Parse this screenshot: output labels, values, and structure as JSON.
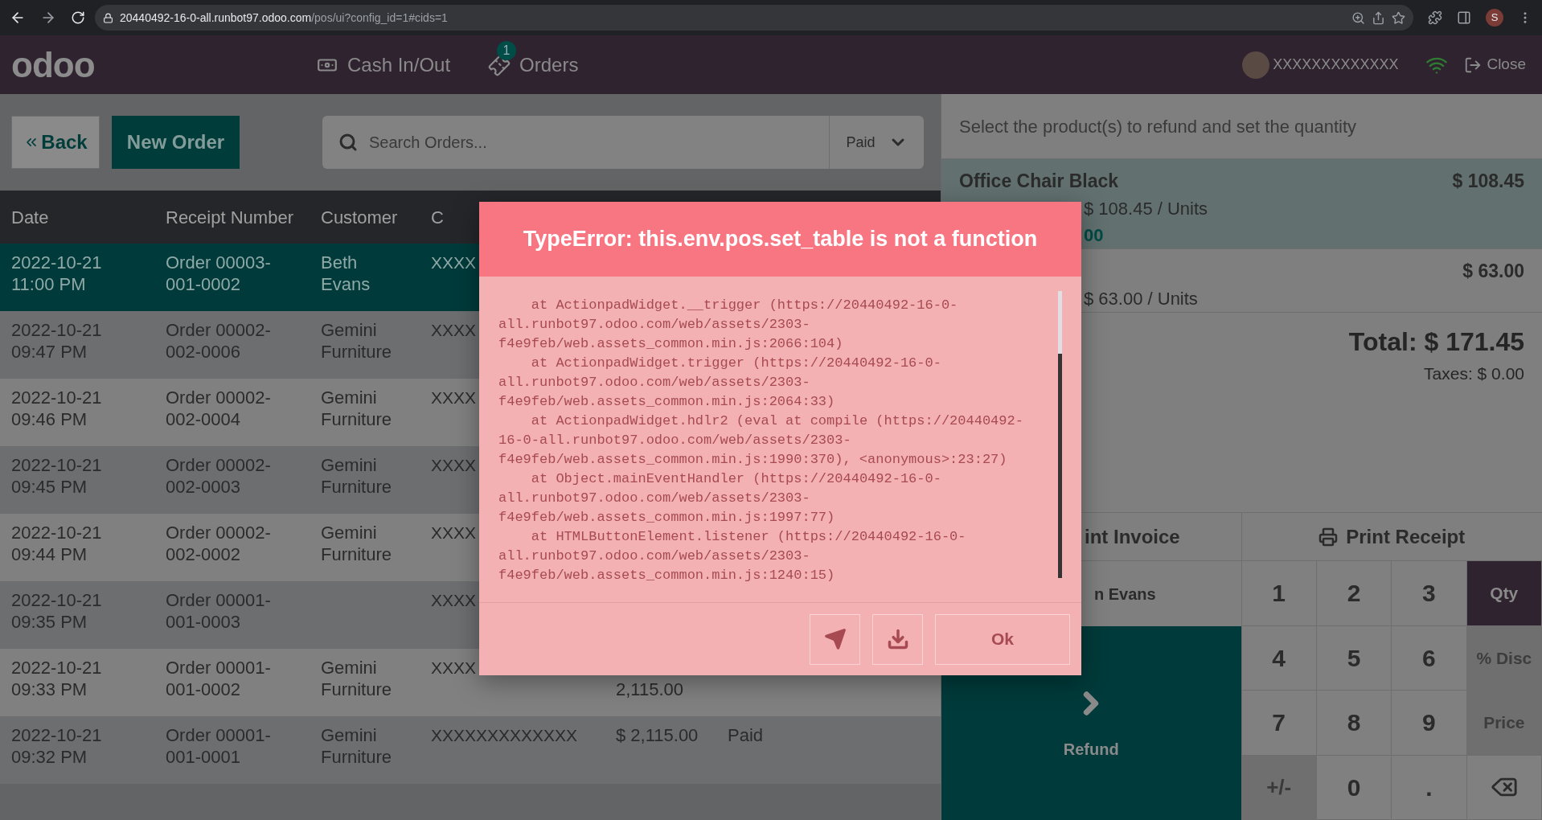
{
  "browser": {
    "url_host": "20440492-16-0-all.runbot97.odoo.com",
    "url_path": "/pos/ui?config_id=1#cids=1",
    "profile_initial": "S"
  },
  "header": {
    "logo": "odoo",
    "nav": [
      {
        "kind": "cash",
        "label": "Cash In/Out"
      },
      {
        "kind": "orders",
        "label": "Orders",
        "badge": "1"
      }
    ],
    "user": "XXXXXXXXXXXXX",
    "close": "Close"
  },
  "controls": {
    "back": "Back",
    "new_order": "New Order",
    "search": {
      "placeholder": "Search Orders..."
    },
    "filter": "Paid"
  },
  "table": {
    "columns": [
      "Date",
      "Receipt Number",
      "Customer",
      "C"
    ],
    "rows": [
      {
        "selected": true,
        "date": "2022-10-21 11:00 PM",
        "receipt": "Order 00003-001-0002",
        "customer": "Beth Evans",
        "column_4": "XXXX"
      },
      {
        "selected": false,
        "date": "2022-10-21 09:47 PM",
        "receipt": "Order 00002-002-0006",
        "customer": "Gemini Furniture",
        "column_4": "XXXX"
      },
      {
        "selected": false,
        "date": "2022-10-21 09:46 PM",
        "receipt": "Order 00002-002-0004",
        "customer": "Gemini Furniture",
        "column_4": "XXXX"
      },
      {
        "selected": false,
        "date": "2022-10-21 09:45 PM",
        "receipt": "Order 00002-002-0003",
        "customer": "Gemini Furniture",
        "column_4": "XXXX"
      },
      {
        "selected": false,
        "date": "2022-10-21 09:44 PM",
        "receipt": "Order 00002-002-0002",
        "customer": "Gemini Furniture",
        "column_4": "XXXX"
      },
      {
        "selected": false,
        "date": "2022-10-21 09:35 PM",
        "receipt": "Order 00001-001-0003",
        "column_4": "XXXX"
      },
      {
        "selected": false,
        "date": "2022-10-21 09:33 PM",
        "receipt": "Order 00001-001-0002",
        "customer": "Gemini Furniture",
        "column_4": "XXXX",
        "amount_tail": "2,115.00"
      },
      {
        "selected": false,
        "date": "2022-10-21 09:32 PM",
        "receipt": "Order 00001-001-0001",
        "customer": "Gemini Furniture",
        "column_4": "XXXXXXXXXXXXX",
        "amount": "$ 2,115.00",
        "status": "Paid"
      }
    ]
  },
  "refund": {
    "title": "Select the product(s) to refund and set the quantity",
    "lines": [
      {
        "selected": true,
        "name": "Office Chair Black",
        "price": "$ 108.45",
        "detail": "$ 108.45 / Units",
        "refund_qty": "00"
      },
      {
        "selected": false,
        "price": "$ 63.00",
        "detail": "$ 63.00 / Units"
      }
    ],
    "total": "Total: $ 171.45",
    "taxes": "Taxes: $ 0.00",
    "invoice": "int Invoice",
    "receipt": "Print Receipt",
    "customer": "n Evans",
    "action": "Refund",
    "keys": [
      {
        "kind": "digit",
        "label": "1"
      },
      {
        "kind": "digit",
        "label": "2"
      },
      {
        "kind": "digit",
        "label": "3"
      },
      {
        "kind": "mode",
        "label": "Qty",
        "selected": true
      },
      {
        "kind": "digit",
        "label": "4"
      },
      {
        "kind": "digit",
        "label": "5"
      },
      {
        "kind": "digit",
        "label": "6"
      },
      {
        "kind": "mode",
        "label": "% Disc",
        "selected": false
      },
      {
        "kind": "digit",
        "label": "7"
      },
      {
        "kind": "digit",
        "label": "8"
      },
      {
        "kind": "digit",
        "label": "9"
      },
      {
        "kind": "mode",
        "label": "Price",
        "selected": false
      },
      {
        "kind": "sign",
        "label": "+/-"
      },
      {
        "kind": "digit",
        "label": "0"
      },
      {
        "kind": "digit",
        "label": "."
      },
      {
        "kind": "backspace"
      }
    ]
  },
  "dialog": {
    "title": "TypeError: this.env.pos.set_table is not a function",
    "trace": [
      "    at ActionpadWidget.__trigger (https://20440492-16-0-all.runbot97.odoo.com/web/assets/2303-f4e9feb/web.assets_common.min.js:2066:104)",
      "    at ActionpadWidget.trigger (https://20440492-16-0-all.runbot97.odoo.com/web/assets/2303-f4e9feb/web.assets_common.min.js:2064:33)",
      "    at ActionpadWidget.hdlr2 (eval at compile (https://20440492-16-0-all.runbot97.odoo.com/web/assets/2303-f4e9feb/web.assets_common.min.js:1990:370), <anonymous>:23:27)",
      "    at Object.mainEventHandler (https://20440492-16-0-all.runbot97.odoo.com/web/assets/2303-f4e9feb/web.assets_common.min.js:1997:77)",
      "    at HTMLButtonElement.listener (https://20440492-16-0-all.runbot97.odoo.com/web/assets/2303-f4e9feb/web.assets_common.min.js:1240:15)"
    ],
    "ok": "Ok"
  }
}
